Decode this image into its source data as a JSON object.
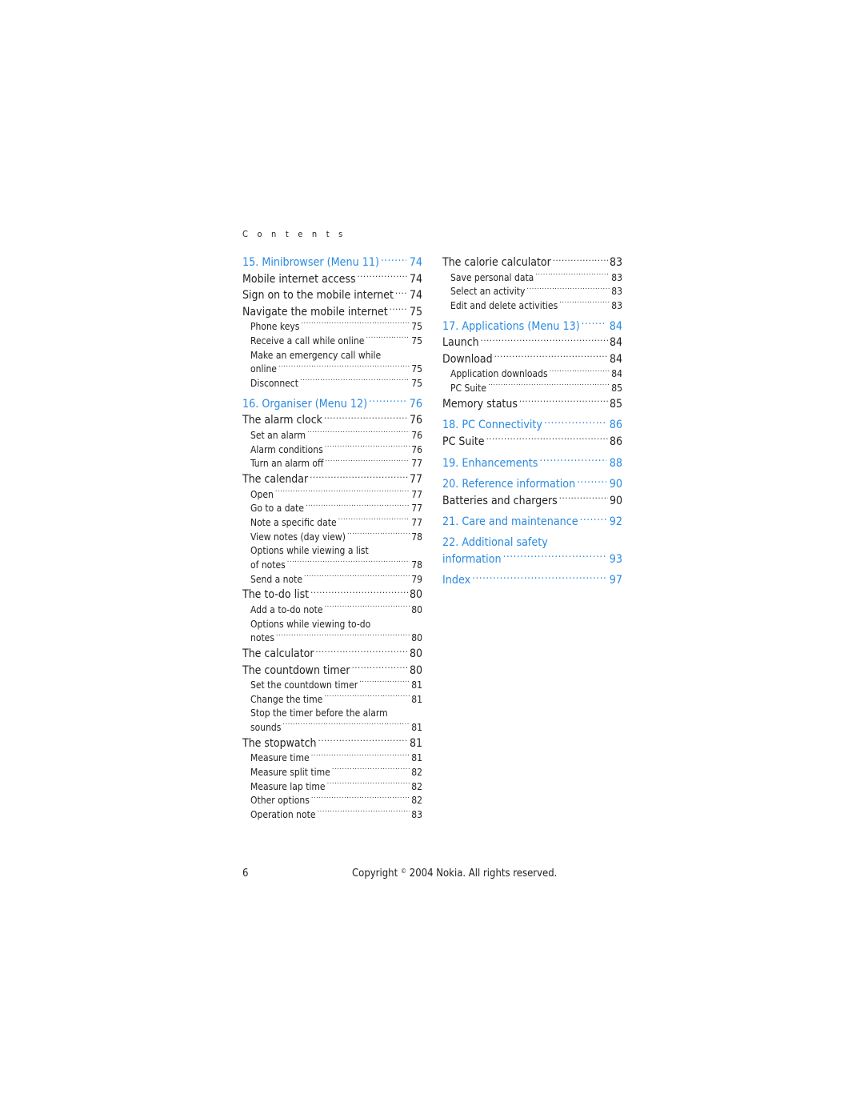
{
  "header": {
    "section_label": "C o n t e n t s"
  },
  "colors": {
    "chapter": "#2a8ae0",
    "text": "#231f20"
  },
  "left_column": [
    {
      "level": "chapter",
      "title": "15. Minibrowser (Menu 11)",
      "page": "74"
    },
    {
      "level": "section",
      "title": "Mobile internet access",
      "page": "74"
    },
    {
      "level": "section",
      "title": "Sign on to the mobile internet",
      "page": "74"
    },
    {
      "level": "section",
      "title": "Navigate the mobile internet",
      "page": "75"
    },
    {
      "level": "sub",
      "title": "Phone keys",
      "page": "75"
    },
    {
      "level": "sub",
      "title": "Receive a call while online",
      "page": "75"
    },
    {
      "level": "sub-wrap",
      "title_line1": "Make an emergency call while",
      "title": "online",
      "page": "75"
    },
    {
      "level": "sub",
      "title": "Disconnect",
      "page": "75"
    },
    {
      "level": "chapter",
      "title": "16. Organiser (Menu 12)",
      "page": "76"
    },
    {
      "level": "section",
      "title": "The alarm clock",
      "page": "76"
    },
    {
      "level": "sub",
      "title": "Set an alarm",
      "page": "76"
    },
    {
      "level": "sub",
      "title": "Alarm conditions",
      "page": "76"
    },
    {
      "level": "sub",
      "title": "Turn an alarm off",
      "page": "77"
    },
    {
      "level": "section",
      "title": "The calendar",
      "page": "77"
    },
    {
      "level": "sub",
      "title": "Open",
      "page": "77"
    },
    {
      "level": "sub",
      "title": "Go to a date",
      "page": "77"
    },
    {
      "level": "sub",
      "title": "Note a specific date",
      "page": "77"
    },
    {
      "level": "sub",
      "title": "View notes (day view)",
      "page": "78"
    },
    {
      "level": "sub-wrap",
      "title_line1": "Options while viewing a list",
      "title": "of notes",
      "page": "78"
    },
    {
      "level": "sub",
      "title": "Send a note",
      "page": "79"
    },
    {
      "level": "section",
      "title": "The to-do list",
      "page": "80"
    },
    {
      "level": "sub",
      "title": "Add a to-do note",
      "page": "80"
    },
    {
      "level": "sub-wrap",
      "title_line1": "Options while viewing to-do",
      "title": "notes",
      "page": "80"
    },
    {
      "level": "section",
      "title": "The calculator",
      "page": "80"
    },
    {
      "level": "section",
      "title": "The countdown timer",
      "page": "80"
    },
    {
      "level": "sub",
      "title": "Set the countdown timer",
      "page": "81"
    },
    {
      "level": "sub",
      "title": "Change the time",
      "page": "81"
    },
    {
      "level": "sub-wrap",
      "title_line1": "Stop the timer before the alarm",
      "title": "sounds",
      "page": "81"
    },
    {
      "level": "section",
      "title": "The stopwatch",
      "page": "81"
    },
    {
      "level": "sub",
      "title": "Measure time",
      "page": "81"
    },
    {
      "level": "sub",
      "title": "Measure split time",
      "page": "82"
    },
    {
      "level": "sub",
      "title": "Measure lap time",
      "page": "82"
    },
    {
      "level": "sub",
      "title": "Other options",
      "page": "82"
    },
    {
      "level": "sub",
      "title": "Operation note",
      "page": "83"
    }
  ],
  "right_column": [
    {
      "level": "section",
      "title": "The calorie calculator",
      "page": "83"
    },
    {
      "level": "sub",
      "title": "Save personal data",
      "page": "83"
    },
    {
      "level": "sub",
      "title": "Select an activity",
      "page": "83"
    },
    {
      "level": "sub",
      "title": "Edit and delete activities",
      "page": "83"
    },
    {
      "level": "chapter",
      "title": "17. Applications (Menu 13)",
      "page": "84"
    },
    {
      "level": "section",
      "title": "Launch",
      "page": "84"
    },
    {
      "level": "section",
      "title": "Download",
      "page": "84"
    },
    {
      "level": "sub",
      "title": "Application downloads",
      "page": "84"
    },
    {
      "level": "sub",
      "title": "PC Suite",
      "page": "85"
    },
    {
      "level": "section",
      "title": "Memory status",
      "page": "85"
    },
    {
      "level": "chapter",
      "title": "18. PC Connectivity",
      "page": "86"
    },
    {
      "level": "section",
      "title": "PC Suite",
      "page": "86"
    },
    {
      "level": "chapter",
      "title": "19. Enhancements",
      "page": "88"
    },
    {
      "level": "chapter",
      "title": "20. Reference information",
      "page": "90"
    },
    {
      "level": "section",
      "title": "Batteries and chargers",
      "page": "90"
    },
    {
      "level": "chapter",
      "title": "21. Care and maintenance",
      "page": "92"
    },
    {
      "level": "chapter-wrap",
      "title_line1": "22. Additional safety",
      "title": "information",
      "page": "93"
    },
    {
      "level": "chapter",
      "title": "Index",
      "page": "97"
    }
  ],
  "footer": {
    "page_number": "6",
    "copyright_prefix": "Copyright",
    "copyright_symbol": "©",
    "copyright_suffix": "2004 Nokia. All rights reserved."
  }
}
